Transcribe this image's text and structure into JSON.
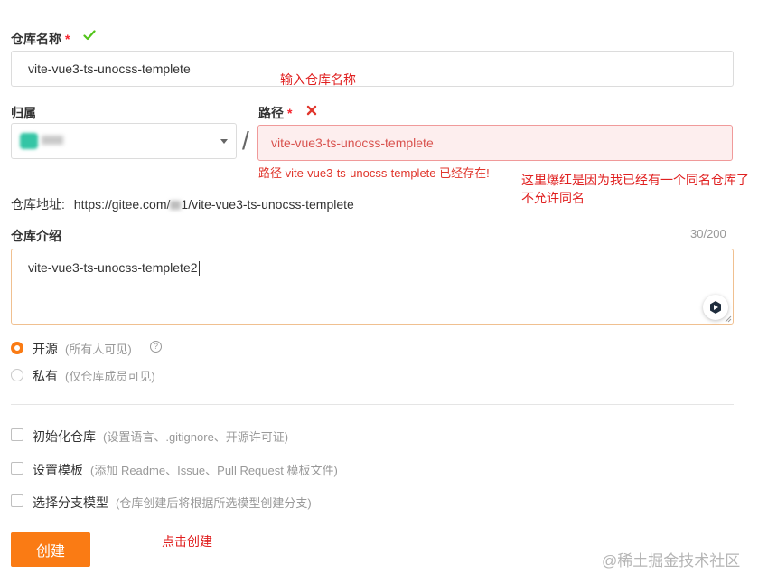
{
  "form": {
    "repo_name": {
      "label": "仓库名称",
      "required_mark": "*",
      "value": "vite-vue3-ts-unocss-templete"
    },
    "owner": {
      "label": "归属"
    },
    "path": {
      "label": "路径",
      "required_mark": "*",
      "separator": "/",
      "value": "vite-vue3-ts-unocss-templete",
      "error_message": "路径 vite-vue3-ts-unocss-templete 已经存在!"
    },
    "repo_url": {
      "label": "仓库地址:",
      "prefix": "https://gitee.com/",
      "masked_tail": "1",
      "suffix": "/vite-vue3-ts-unocss-templete"
    },
    "description": {
      "label": "仓库介绍",
      "counter": "30/200",
      "value": "vite-vue3-ts-unocss-templete2"
    },
    "visibility": {
      "public": {
        "label": "开源",
        "hint": "(所有人可见)",
        "help_glyph": "?"
      },
      "private": {
        "label": "私有",
        "hint": "(仅仓库成员可见)"
      }
    },
    "options": {
      "init": {
        "label": "初始化仓库",
        "hint": "(设置语言、.gitignore、开源许可证)"
      },
      "template": {
        "label": "设置模板",
        "hint": "(添加 Readme、Issue、Pull Request 模板文件)"
      },
      "branch_model": {
        "label": "选择分支模型",
        "hint": "(仓库创建后将根据所选模型创建分支)"
      }
    },
    "create_button": "创建"
  },
  "annotations": {
    "input_name": "输入仓库名称",
    "error_line1": "这里爆红是因为我已经有一个同名仓库了",
    "error_line2": "不允许同名",
    "click_create": "点击创建"
  },
  "watermark": "@稀土掘金技术社区",
  "colors": {
    "accent": "#fa7b14",
    "error": "#e02020",
    "success": "#52c41a"
  }
}
